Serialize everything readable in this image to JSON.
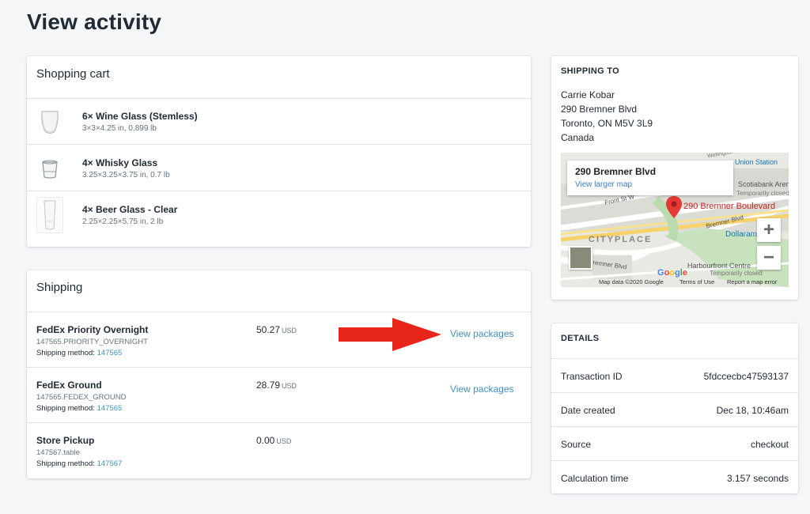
{
  "page": {
    "title": "View activity"
  },
  "cart": {
    "title": "Shopping cart",
    "items": [
      {
        "name": "6× Wine Glass (Stemless)",
        "meta": "3×3×4.25 in, 0.899 lb",
        "icon": "wine-glass-icon"
      },
      {
        "name": "4× Whisky Glass",
        "meta": "3.25×3.25×3.75 in, 0.7 lb",
        "icon": "whisky-glass-icon"
      },
      {
        "name": "4× Beer Glass - Clear",
        "meta": "2.25×2.25×5.75 in, 2 lb",
        "icon": "beer-glass-icon"
      }
    ]
  },
  "shipping": {
    "title": "Shipping",
    "method_label": "Shipping method:",
    "rows": [
      {
        "name": "FedEx Priority Overnight",
        "code": "147565.PRIORITY_OVERNIGHT",
        "method_id": "147565",
        "price": "50.27",
        "currency": "USD",
        "action": "View packages"
      },
      {
        "name": "FedEx Ground",
        "code": "147565.FEDEX_GROUND",
        "method_id": "147565",
        "price": "28.79",
        "currency": "USD",
        "action": "View packages"
      },
      {
        "name": "Store Pickup",
        "code": "147567.table",
        "method_id": "147567",
        "price": "0.00",
        "currency": "USD",
        "action": ""
      }
    ]
  },
  "ship_to": {
    "label": "SHIPPING TO",
    "address": [
      "Carrie Kobar",
      "290 Bremner Blvd",
      "Toronto, ON M5V 3L9",
      "Canada"
    ],
    "map": {
      "popup_name": "290 Bremner Blvd",
      "popup_link": "View larger map",
      "pin_label": "290 Bremner Boulevard",
      "labels": [
        "Union Station",
        "Scotiabank Arena",
        "Temporarily closed",
        "Front St W",
        "Bremner Blvd",
        "CITYPLACE",
        "Dollarama",
        "Harbourfront Centre",
        "Temporarily closed",
        "Bremner Blvd",
        "Wellington St"
      ],
      "logo": "Google",
      "footer": [
        "Map data ©2020 Google",
        "Terms of Use",
        "Report a map error"
      ],
      "zoom_in": "+",
      "zoom_out": "−"
    }
  },
  "details": {
    "label": "DETAILS",
    "rows": [
      {
        "key": "Transaction ID",
        "value": "5fdccecbc47593137"
      },
      {
        "key": "Date created",
        "value": "Dec 18, 10:46am"
      },
      {
        "key": "Source",
        "value": "checkout"
      },
      {
        "key": "Calculation time",
        "value": "3.157 seconds"
      }
    ]
  },
  "colors": {
    "link": "#3f8fc6",
    "arrow": "#e8251b",
    "background": "#f4f6f8",
    "map_pin": "#e53935"
  }
}
